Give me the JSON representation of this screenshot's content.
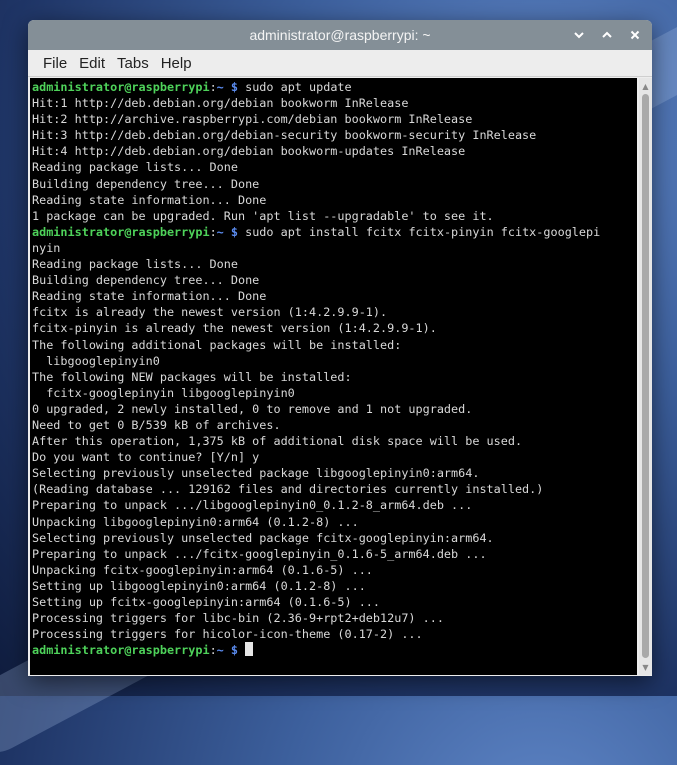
{
  "window": {
    "title": "administrator@raspberrypi: ~"
  },
  "menu": [
    "File",
    "Edit",
    "Tabs",
    "Help"
  ],
  "prompt": {
    "user_host": "administrator@raspberrypi",
    "sep": ":",
    "path": "~",
    "symbol": " $ "
  },
  "lines": [
    {
      "type": "prompt",
      "cmd": "sudo apt update"
    },
    {
      "type": "text",
      "text": "Hit:1 http://deb.debian.org/debian bookworm InRelease"
    },
    {
      "type": "text",
      "text": "Hit:2 http://archive.raspberrypi.com/debian bookworm InRelease"
    },
    {
      "type": "text",
      "text": "Hit:3 http://deb.debian.org/debian-security bookworm-security InRelease"
    },
    {
      "type": "text",
      "text": "Hit:4 http://deb.debian.org/debian bookworm-updates InRelease"
    },
    {
      "type": "text",
      "text": "Reading package lists... Done"
    },
    {
      "type": "text",
      "text": "Building dependency tree... Done"
    },
    {
      "type": "text",
      "text": "Reading state information... Done"
    },
    {
      "type": "text",
      "text": "1 package can be upgraded. Run 'apt list --upgradable' to see it."
    },
    {
      "type": "prompt",
      "cmd": "sudo apt install fcitx fcitx-pinyin fcitx-googlepi"
    },
    {
      "type": "text",
      "text": "nyin"
    },
    {
      "type": "text",
      "text": "Reading package lists... Done"
    },
    {
      "type": "text",
      "text": "Building dependency tree... Done"
    },
    {
      "type": "text",
      "text": "Reading state information... Done"
    },
    {
      "type": "text",
      "text": "fcitx is already the newest version (1:4.2.9.9-1)."
    },
    {
      "type": "text",
      "text": "fcitx-pinyin is already the newest version (1:4.2.9.9-1)."
    },
    {
      "type": "text",
      "text": "The following additional packages will be installed:"
    },
    {
      "type": "text",
      "text": "  libgooglepinyin0"
    },
    {
      "type": "text",
      "text": "The following NEW packages will be installed:"
    },
    {
      "type": "text",
      "text": "  fcitx-googlepinyin libgooglepinyin0"
    },
    {
      "type": "text",
      "text": "0 upgraded, 2 newly installed, 0 to remove and 1 not upgraded."
    },
    {
      "type": "text",
      "text": "Need to get 0 B/539 kB of archives."
    },
    {
      "type": "text",
      "text": "After this operation, 1,375 kB of additional disk space will be used."
    },
    {
      "type": "text",
      "text": "Do you want to continue? [Y/n] y"
    },
    {
      "type": "text",
      "text": "Selecting previously unselected package libgooglepinyin0:arm64."
    },
    {
      "type": "text",
      "text": "(Reading database ... 129162 files and directories currently installed.)"
    },
    {
      "type": "text",
      "text": "Preparing to unpack .../libgooglepinyin0_0.1.2-8_arm64.deb ..."
    },
    {
      "type": "text",
      "text": "Unpacking libgooglepinyin0:arm64 (0.1.2-8) ..."
    },
    {
      "type": "text",
      "text": "Selecting previously unselected package fcitx-googlepinyin:arm64."
    },
    {
      "type": "text",
      "text": "Preparing to unpack .../fcitx-googlepinyin_0.1.6-5_arm64.deb ..."
    },
    {
      "type": "text",
      "text": "Unpacking fcitx-googlepinyin:arm64 (0.1.6-5) ..."
    },
    {
      "type": "text",
      "text": "Setting up libgooglepinyin0:arm64 (0.1.2-8) ..."
    },
    {
      "type": "text",
      "text": "Setting up fcitx-googlepinyin:arm64 (0.1.6-5) ..."
    },
    {
      "type": "text",
      "text": "Processing triggers for libc-bin (2.36-9+rpt2+deb12u7) ..."
    },
    {
      "type": "text",
      "text": "Processing triggers for hicolor-icon-theme (0.17-2) ..."
    },
    {
      "type": "prompt",
      "cmd": "",
      "cursor": true
    }
  ],
  "colors": {
    "prompt_user": "#4ed25a",
    "prompt_path": "#5b8cf0",
    "titlebar": "#848f97",
    "terminal_bg": "#000000"
  },
  "icons": {
    "minimize": "chevron-down-icon",
    "maximize": "chevron-up-icon",
    "close": "close-icon"
  }
}
